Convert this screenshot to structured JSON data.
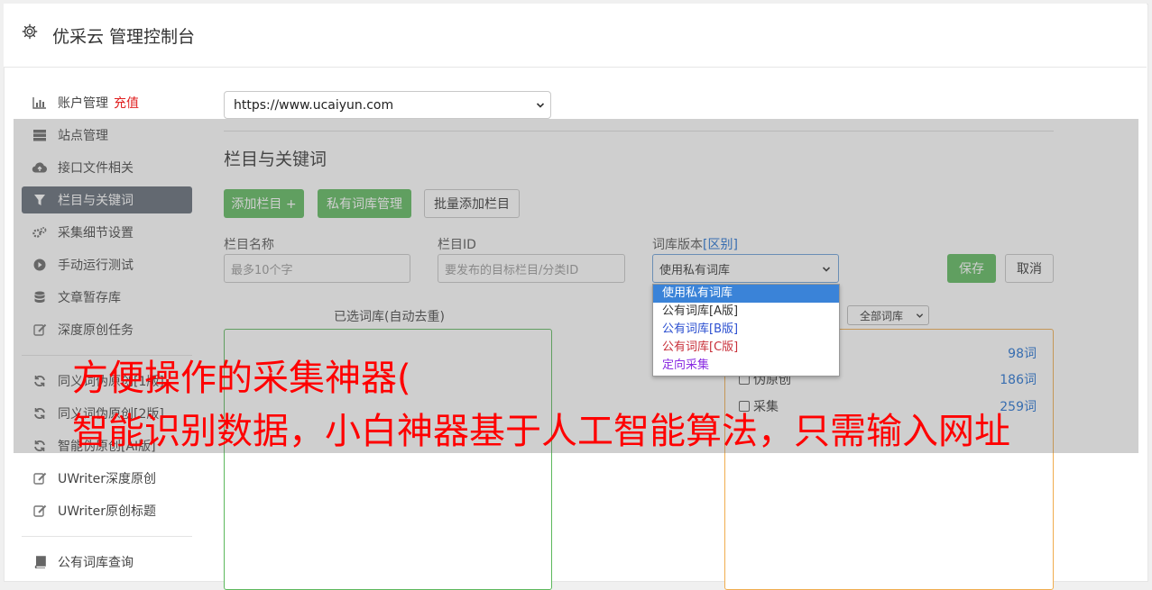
{
  "header": {
    "title": "优采云 管理控制台",
    "icon": "gear-icon"
  },
  "sidebar": {
    "items": [
      {
        "label": "账户管理",
        "extra": "充值",
        "icon": "bar-chart-icon"
      },
      {
        "label": "站点管理",
        "icon": "server-icon"
      },
      {
        "label": "接口文件相关",
        "icon": "cloud-upload-icon"
      },
      {
        "label": "栏目与关键词",
        "icon": "filter-icon",
        "active": true
      },
      {
        "label": "采集细节设置",
        "icon": "cogs-icon"
      },
      {
        "label": "手动运行测试",
        "icon": "play-circle-icon"
      },
      {
        "label": "文章暂存库",
        "icon": "database-icon"
      },
      {
        "label": "深度原创任务",
        "icon": "edit-icon"
      },
      {
        "label": "同义词伪原创[1版]",
        "icon": "refresh-icon"
      },
      {
        "label": "同义词伪原创[2版]",
        "icon": "refresh-icon"
      },
      {
        "label": "智能伪原创[AI版]",
        "icon": "refresh-icon"
      },
      {
        "label": "UWriter深度原创",
        "icon": "edit-icon"
      },
      {
        "label": "UWriter原创标题",
        "icon": "edit-icon"
      },
      {
        "label": "公有词库查询",
        "icon": "book-icon"
      }
    ]
  },
  "site_select": {
    "value": "https://www.ucaiyun.com"
  },
  "section": {
    "title": "栏目与关键词"
  },
  "buttons": {
    "add_column": "添加栏目 +",
    "private_lib": "私有词库管理",
    "batch_add": "批量添加栏目",
    "save": "保存",
    "cancel": "取消"
  },
  "form": {
    "name_label": "栏目名称",
    "name_placeholder": "最多10个字",
    "id_label": "栏目ID",
    "id_placeholder": "要发布的目标栏目/分类ID",
    "version_label": "词库版本",
    "version_link": "[区别]",
    "version_value": "使用私有词库"
  },
  "version_options": [
    {
      "label": "使用私有词库",
      "color": "#ffffff",
      "selected": true
    },
    {
      "label": "公有词库[A版]",
      "color": "#333333"
    },
    {
      "label": "公有词库[B版]",
      "color": "#2b4fd0"
    },
    {
      "label": "公有词库[C版]",
      "color": "#c8303a"
    },
    {
      "label": "定向采集",
      "color": "#8a2be2"
    }
  ],
  "selected_panel": {
    "title": "已选词库(自动去重)"
  },
  "library_filter": {
    "value": "全部词库"
  },
  "library_list": [
    {
      "name": "",
      "count": "98词"
    },
    {
      "name": "伪原创",
      "count": "186词"
    },
    {
      "name": "采集",
      "count": "259词"
    }
  ],
  "captions": {
    "line1": "方便操作的采集神器(",
    "line2": "智能识别数据，小白神器基于人工智能算法，只需输入网址"
  }
}
